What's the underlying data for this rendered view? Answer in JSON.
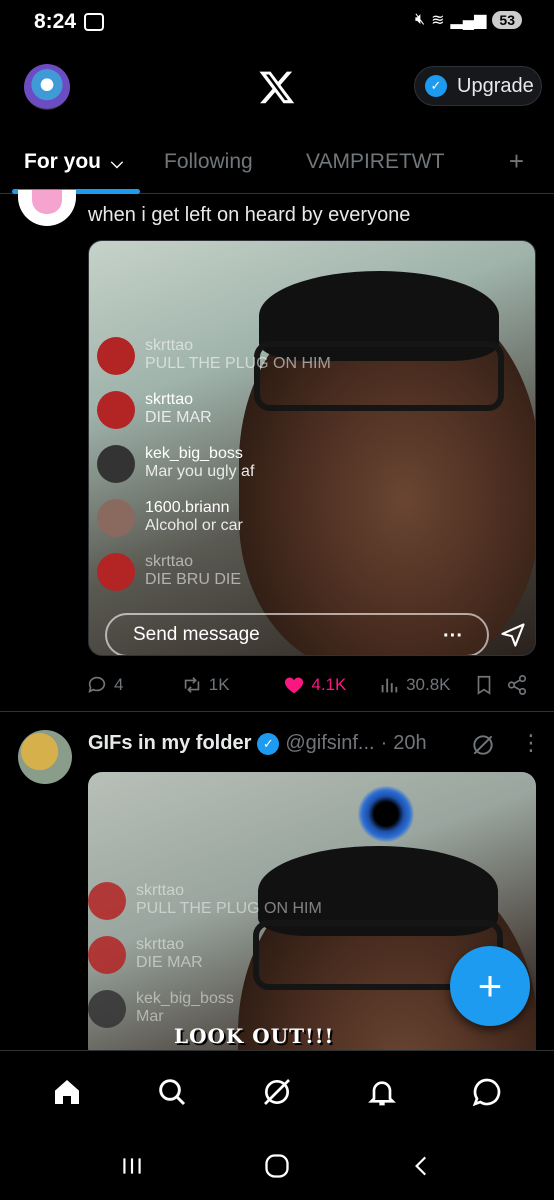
{
  "status_bar": {
    "time": "8:24",
    "battery": "53"
  },
  "header": {
    "upgrade_label": "Upgrade"
  },
  "tabs": [
    {
      "label": "For you",
      "active": true
    },
    {
      "label": "Following",
      "active": false
    },
    {
      "label": "VAMPIRETWT",
      "active": false
    }
  ],
  "post1": {
    "text": "when i get left on heard by everyone",
    "live_comments": [
      {
        "user": "skrttao",
        "message": "PULL THE PLUG ON HIM"
      },
      {
        "user": "skrttao",
        "message": "DIE MAR"
      },
      {
        "user": "kek_big_boss",
        "message": "Mar you ugly af"
      },
      {
        "user": "1600.briann",
        "message": "Alcohol or car"
      },
      {
        "user": "skrttao",
        "message": "DIE BRU DIE"
      }
    ],
    "send_placeholder": "Send message",
    "stats": {
      "replies": "4",
      "reposts": "1K",
      "likes": "4.1K",
      "views": "30.8K"
    }
  },
  "post2": {
    "author": "GIFs in my folder",
    "handle": "@gifsinf...",
    "time": "20h",
    "live_comments": [
      {
        "user": "skrttao",
        "message": "PULL THE PLUG ON HIM"
      },
      {
        "user": "skrttao",
        "message": "DIE MAR"
      },
      {
        "user": "kek_big_boss",
        "message": "Mar"
      }
    ],
    "overlay_text": "LOOK OUT!!!"
  },
  "colors": {
    "accent": "#1d9bf0",
    "like": "#f91880",
    "muted": "#71767b"
  },
  "icons": {
    "bottom_nav": [
      "home-icon",
      "search-icon",
      "grok-icon",
      "notifications-icon",
      "messages-icon"
    ],
    "system_nav": [
      "recents-icon",
      "home-circle-icon",
      "back-icon"
    ]
  }
}
